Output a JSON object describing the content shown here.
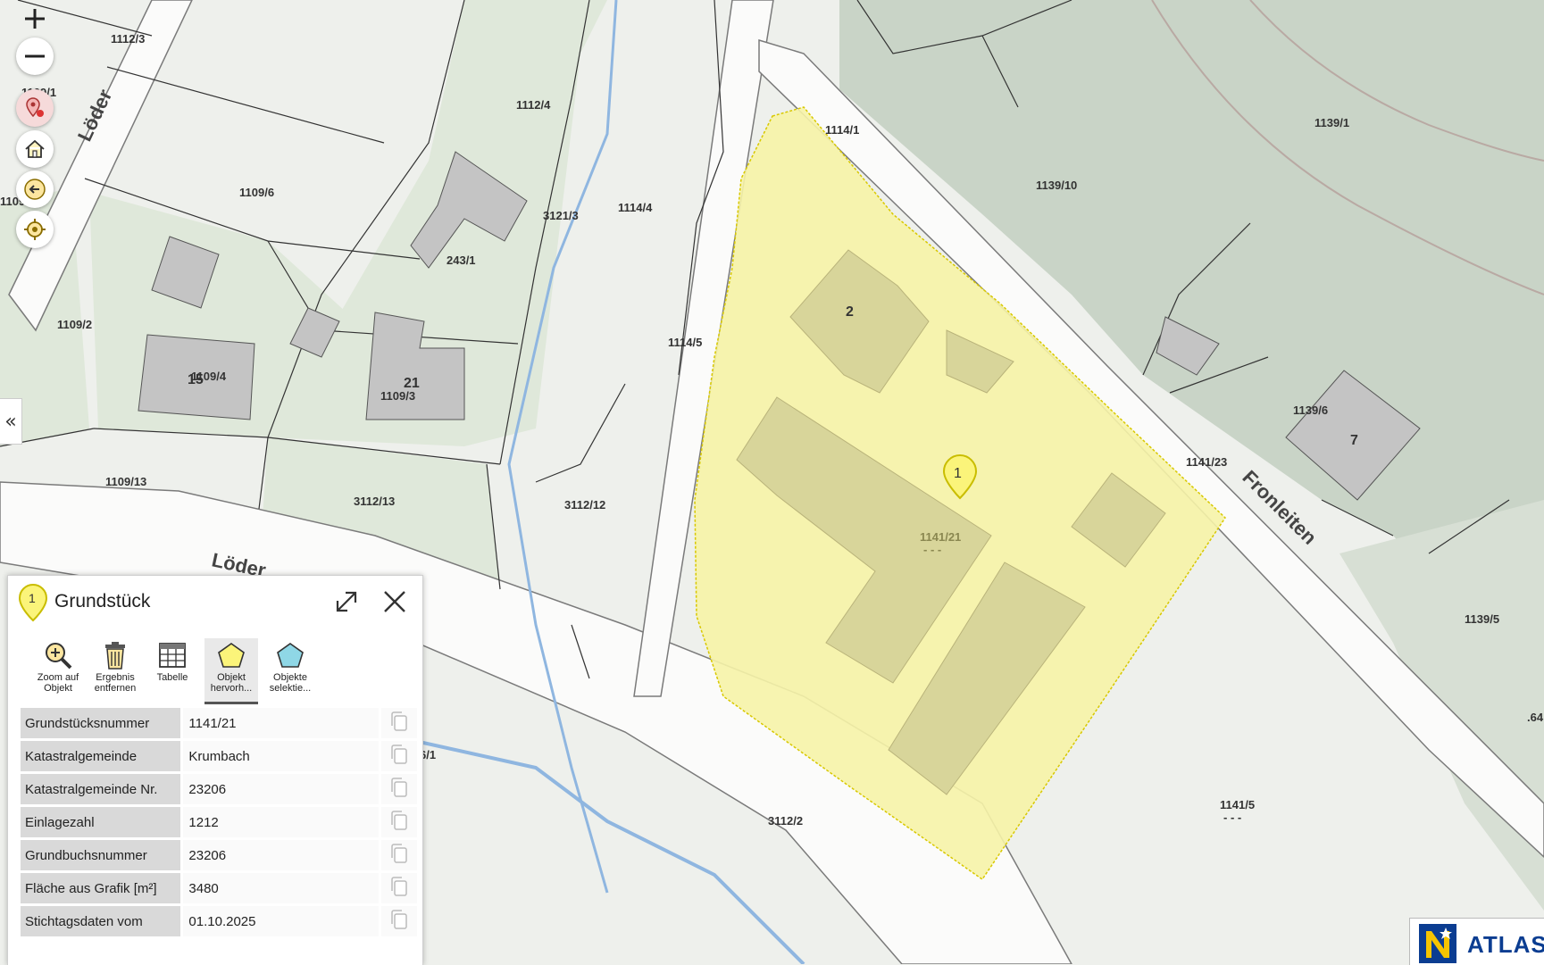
{
  "map": {
    "parcels": {
      "p1112_3": "1112/3",
      "p1109_1": "1109/1",
      "p1109_partial": "1109",
      "p1112_4": "1112/4",
      "p1109_6": "1109/6",
      "p3121_3": "3121/3",
      "p1114_4": "1114/4",
      "p243_1": "243/1",
      "p1109_2": "1109/2",
      "p1109_4": "1109/4",
      "p1109_3": "1109/3",
      "p1114_5": "1114/5",
      "p1114_1": "1114/1",
      "p1139_1": "1139/1",
      "p1139_10": "1139/10",
      "p1139_6": "1139/6",
      "p1141_23": "1141/23",
      "p1141_21": "1141/21",
      "p1141_21_sub": "- - -",
      "p1109_13": "1109/13",
      "p3112_13": "3112/13",
      "p3112_12": "3112/12",
      "p1139_5": "1139/5",
      "p6_1": "6/1",
      "p3112_2": "3112/2",
      "p1141_5": "1141/5",
      "p1141_5_sub": "- - -",
      "p641": ".64"
    },
    "streets": {
      "loeder_top": "Löder",
      "loeder_bottom": "Löder",
      "fronleiten": "Fronleiten"
    },
    "house_numbers": {
      "h2": "2",
      "h21": "21",
      "h7": "7",
      "h15": "15"
    },
    "marker_label": "1",
    "colors": {
      "selected_fill": "#f6f3a7",
      "selected_stroke": "#d8c800",
      "building": "#c4c4c4",
      "building_on_selected": "#d8d59a",
      "green_area": "#dfe8da",
      "water": "#8fb6e0"
    }
  },
  "controls": {
    "zoom_in": "+",
    "zoom_out": "−",
    "side_toggle": "«"
  },
  "panel": {
    "marker": "1",
    "title": "Grundstück",
    "tools": [
      {
        "label": "Zoom auf\nObjekt",
        "icon": "zoom-to-object-icon"
      },
      {
        "label": "Ergebnis\nentfernen",
        "icon": "trash-icon"
      },
      {
        "label": "Tabelle",
        "icon": "table-icon"
      },
      {
        "label": "Objekt\nhervorh...",
        "icon": "highlight-object-icon"
      },
      {
        "label": "Objekte\nselektie...",
        "icon": "select-objects-icon"
      }
    ],
    "rows": [
      {
        "key": "Grundstücksnummer",
        "value": "1141/21"
      },
      {
        "key": "Katastralgemeinde",
        "value": "Krumbach"
      },
      {
        "key": "Katastralgemeinde Nr.",
        "value": "23206"
      },
      {
        "key": "Einlagezahl",
        "value": "1212"
      },
      {
        "key": "Grundbuchsnummer",
        "value": "23206"
      },
      {
        "key": "Fläche aus Grafik [m²]",
        "value": "3480"
      },
      {
        "key": "Stichtagsdaten vom",
        "value": "01.10.2025"
      }
    ]
  },
  "logo": {
    "mark": "N",
    "text": "ATLAS"
  }
}
